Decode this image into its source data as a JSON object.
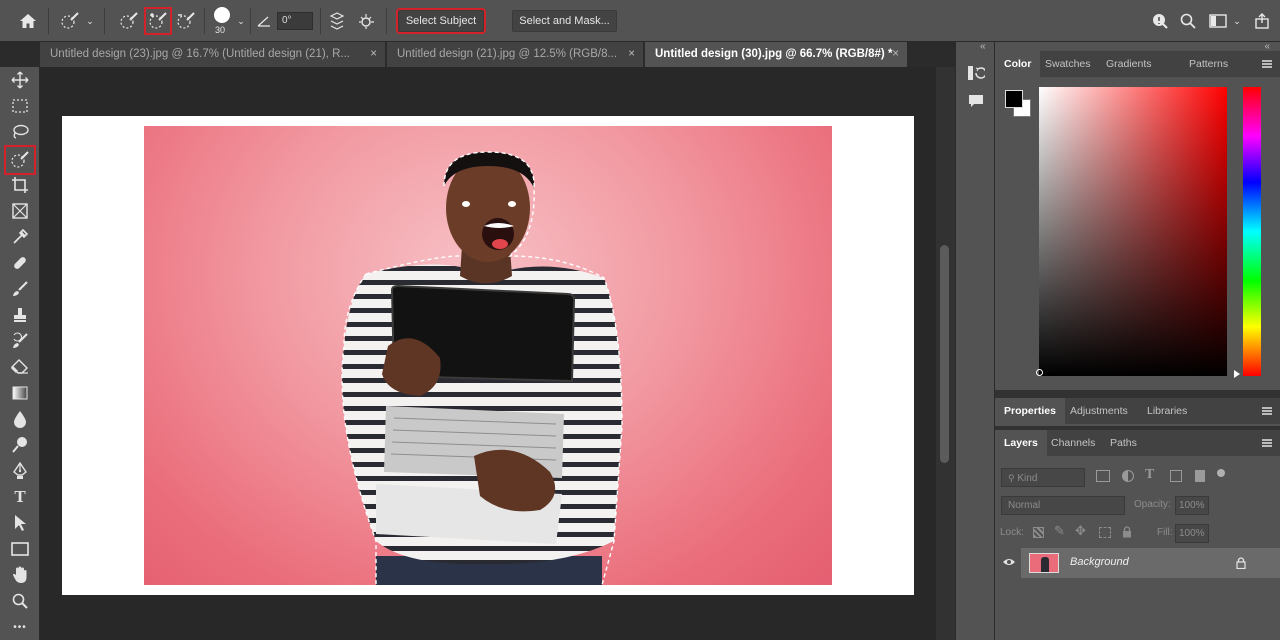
{
  "options_bar": {
    "icons": [
      "home-icon",
      "quick-selection-preset-icon",
      "new-selection-icon",
      "add-to-selection-icon",
      "subtract-from-selection-icon",
      "brush-preview-icon",
      "angle-icon",
      "sample-all-layers-icon",
      "enhance-edge-icon"
    ],
    "brush_size": "30",
    "angle": "0°",
    "select_subject_label": "Select Subject",
    "select_and_mask_label": "Select and Mask..."
  },
  "tabs": [
    {
      "label": "Untitled design (23).jpg @ 16.7% (Untitled design (21), R...",
      "close": "×"
    },
    {
      "label": "Untitled design (21).jpg @ 12.5% (RGB/8...",
      "close": "×"
    },
    {
      "label": "Untitled design (30).jpg @ 66.7% (RGB/8#) *",
      "close": "×",
      "active": true
    }
  ],
  "toolbar": {
    "expand": "»",
    "more": "•••",
    "active_tool": "quick-selection-tool"
  },
  "color_panel": {
    "tabs": [
      "Color",
      "Swatches",
      "Gradients",
      "Patterns"
    ],
    "foreground": "#000000",
    "background": "#ffffff",
    "hue": "#ff0000"
  },
  "properties_panel": {
    "tabs": [
      "Properties",
      "Adjustments",
      "Libraries"
    ]
  },
  "layers_panel": {
    "tabs": [
      "Layers",
      "Channels",
      "Paths"
    ],
    "filter_placeholder": "Kind",
    "blend_mode": "Normal",
    "opacity_label": "Opacity:",
    "opacity_value": "100%",
    "lock_label": "Lock:",
    "fill_label": "Fill:",
    "fill_value": "100%",
    "layers": [
      {
        "name": "Background",
        "visible": true,
        "locked": true
      }
    ]
  },
  "colors": {
    "highlight": "#d3222a",
    "photo_background": "#ea6c7a"
  }
}
